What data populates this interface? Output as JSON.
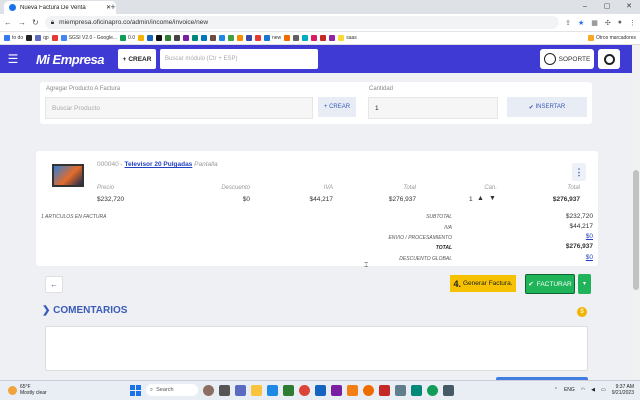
{
  "browser": {
    "tab_title": "Nueva Factura De Venta",
    "url": "miempresa.oficinapro.co/admin/income/invoice/new",
    "bookmarks": [
      "to do",
      "qp",
      "SGSI V2.0 - Google...",
      "0.0",
      "new",
      "saas"
    ],
    "other_bookmarks": "Otros marcadores"
  },
  "appbar": {
    "logo": "Mi Empresa",
    "create_label": "CREAR",
    "search_placeholder": "Buscar módulo (Ctr + ESP)",
    "support_label": "SOPORTE"
  },
  "add_product": {
    "title": "Agregar Producto A Factura",
    "product_placeholder": "Buscar Producto",
    "create_label": "+ CREAR",
    "qty_label": "Cantidad",
    "qty_value": "1",
    "insert_label": "INSERTAR"
  },
  "item": {
    "code": "000040",
    "name": "Televisor 20 Pulgadas",
    "category": "Pantalla",
    "headers": {
      "price": "Precio",
      "discount": "Descuento",
      "tax": "IVA",
      "total": "Total",
      "qty": "Can.",
      "line_total": "Total"
    },
    "price": "$232,720",
    "discount": "$0",
    "tax": "$44,217",
    "total": "$276,937",
    "qty": "1",
    "line_total": "$276,937"
  },
  "summary": {
    "count_label": "1 ARTICULOS EN FACTURA",
    "rows": [
      {
        "label": "SUBTOTAL",
        "value": "$232,720"
      },
      {
        "label": "IVA",
        "value": "$44,217"
      },
      {
        "label": "ENVIO / PROCESAMIENTO",
        "value": "$0"
      },
      {
        "label": "TOTAL",
        "value": "$276,937"
      },
      {
        "label": "DESCUENTO GLOBAL",
        "value": "$0"
      }
    ]
  },
  "actions": {
    "step_number": "4.",
    "step_label": "Generar Factura.",
    "invoice_label": "FACTURAR"
  },
  "comments": {
    "title": "COMENTARIOS"
  },
  "taskbar": {
    "weather_temp": "65°F",
    "weather_desc": "Mostly clear",
    "weather_badge": "1",
    "search_label": "Search",
    "lang": "ENG",
    "time": "9:37 AM",
    "date": "9/21/2023"
  }
}
